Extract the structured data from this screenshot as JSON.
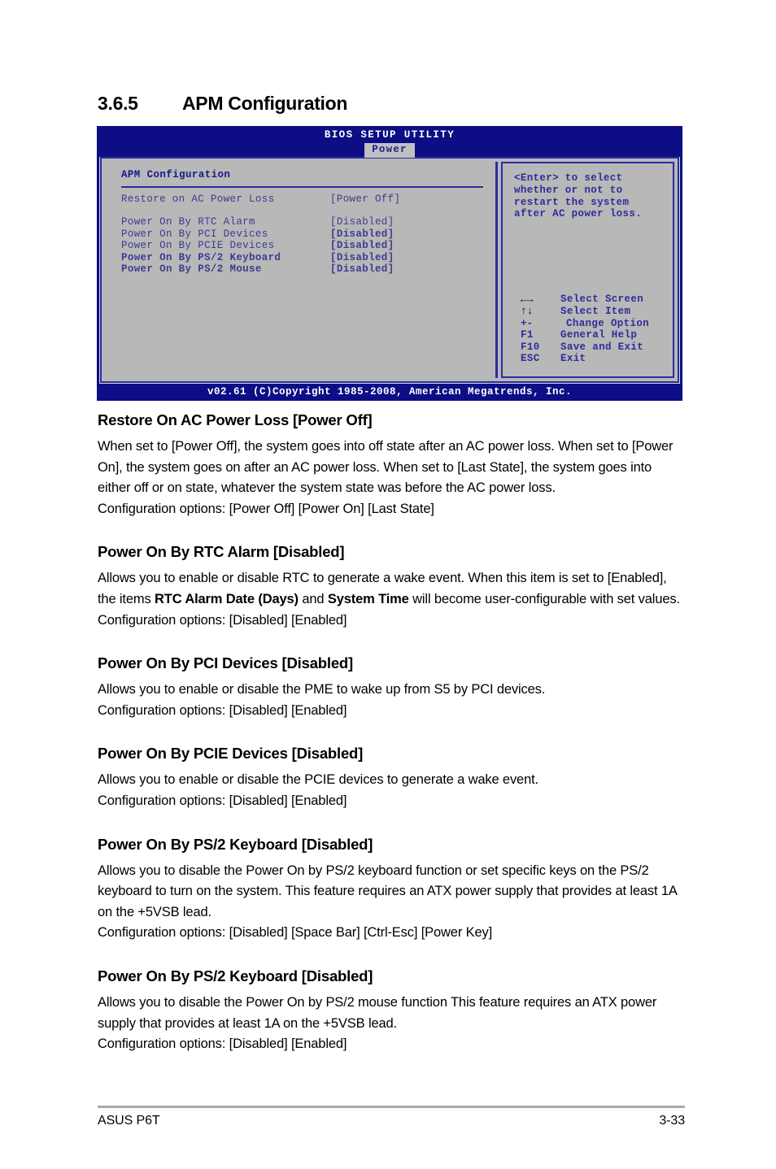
{
  "section": {
    "number": "3.6.5",
    "title": "APM Configuration"
  },
  "bios": {
    "title": "BIOS SETUP UTILITY",
    "active_tab": "Power",
    "panel_heading": "APM Configuration",
    "settings": [
      {
        "label": "Restore on AC Power Loss",
        "value": "[Power Off]"
      },
      {
        "label": "Power On By RTC Alarm",
        "value": "[Disabled]"
      },
      {
        "label": "Power On By PCI Devices",
        "value": "[Disabled]"
      },
      {
        "label": "Power On By PCIE Devices",
        "value": "[Disabled]"
      },
      {
        "label": "Power On By PS/2 Keyboard",
        "value": "[Disabled]"
      },
      {
        "label": "Power On By PS/2 Mouse",
        "value": "[Disabled]"
      }
    ],
    "help_text": "<Enter> to select whether or not to restart the system after AC power loss.",
    "help_lines": [
      "<Enter> to select",
      "whether or not to",
      "restart the system",
      "after AC power loss."
    ],
    "keys": [
      {
        "key": "←→",
        "icon": "left-right-arrow-icon",
        "desc": "Select Screen"
      },
      {
        "key": "↑↓",
        "icon": "up-down-arrow-icon",
        "desc": "Select Item"
      },
      {
        "key": "+-",
        "icon": "plus-minus-icon",
        "desc": "Change Option"
      },
      {
        "key": "F1",
        "icon": "f1-key",
        "desc": "General Help"
      },
      {
        "key": "F10",
        "icon": "f10-key",
        "desc": "Save and Exit"
      },
      {
        "key": "ESC",
        "icon": "esc-key",
        "desc": "Exit"
      }
    ],
    "footer": "v02.61 (C)Copyright 1985-2008, American Megatrends, Inc.",
    "colors": {
      "chrome_blue": "#0d0d85",
      "panel_gray": "#b8b8b8",
      "border_blue": "#2c2ca0",
      "text_blue": "#3c3c90",
      "tab_bg": "#c0c0c0"
    }
  },
  "sections": [
    {
      "heading": "Restore On AC Power Loss [Power Off]",
      "para_1_a": "When set to [Power Off], the system goes into off state after an AC power loss. When set to [Power On], the system goes on after an AC power loss. When set to [Last State], the system goes into either off or on state, whatever the system state was before the AC power loss.",
      "para_2": "Configuration options: [Power Off] [Power On] [Last State]"
    },
    {
      "heading": "Power On By RTC Alarm [Disabled]",
      "para_1_a": "Allows you to enable or disable RTC to generate a wake event. When this item is set to [Enabled], the items ",
      "bold_1": "RTC Alarm Date (Days)",
      "para_1_b": " and ",
      "bold_2": "System Time",
      "para_1_c": " will become user-configurable with set values.",
      "para_2": "Configuration options: [Disabled] [Enabled]"
    },
    {
      "heading": "Power On By PCI Devices [Disabled]",
      "para_1_a": "Allows you to enable or disable the PME to wake up from S5 by PCI devices.",
      "para_2": "Configuration options: [Disabled] [Enabled]"
    },
    {
      "heading": "Power On By PCIE Devices [Disabled]",
      "para_1_a": "Allows you to enable or disable the PCIE devices to generate a wake event.",
      "para_2": "Configuration options: [Disabled] [Enabled]"
    },
    {
      "heading": "Power On By PS/2 Keyboard [Disabled]",
      "para_1_a": "Allows you to disable the Power On by PS/2 keyboard function or set specific keys on the PS/2 keyboard to turn on the system. This feature requires an ATX power supply that provides at least 1A on the +5VSB lead.",
      "para_2": "Configuration options: [Disabled] [Space Bar] [Ctrl-Esc] [Power Key]"
    },
    {
      "heading": "Power On By PS/2 Keyboard [Disabled]",
      "para_1_a": "Allows you to disable the Power On by PS/2 mouse function This feature requires an ATX power supply that provides at least 1A on the +5VSB lead.",
      "para_2": "Configuration options: [Disabled] [Enabled]"
    }
  ],
  "page_footer": {
    "left": "ASUS P6T",
    "right": "3-33"
  }
}
